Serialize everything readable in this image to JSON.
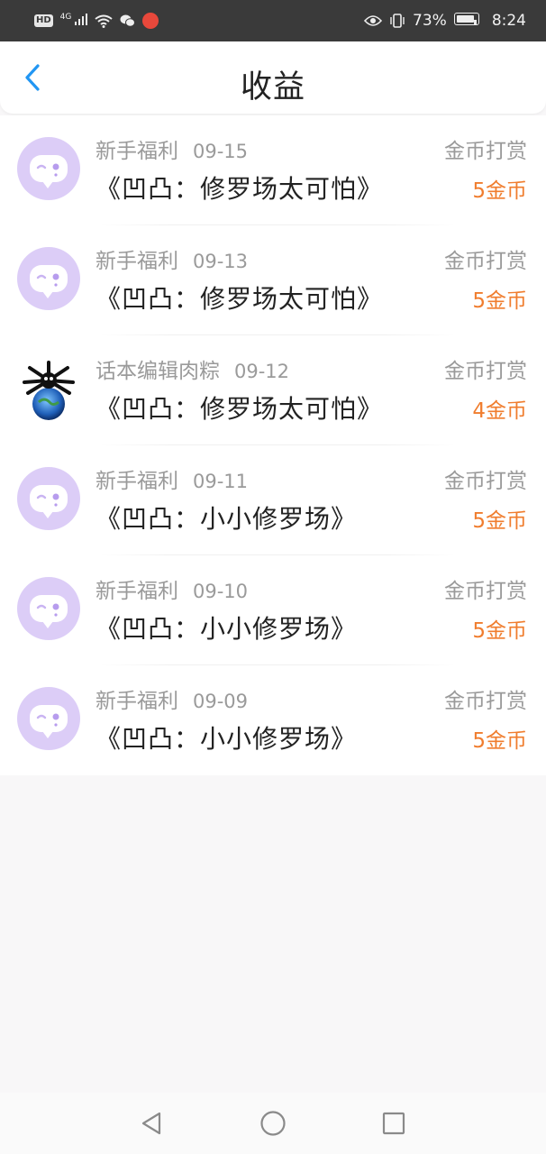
{
  "status_bar": {
    "battery": "73%",
    "time": "8:24",
    "network": "4G",
    "hd": "HD"
  },
  "header": {
    "title": "收益",
    "back_icon": "chevron-left-icon",
    "accent_color": "#2196f3"
  },
  "items": [
    {
      "source": "新手福利",
      "date": "09-15",
      "reward_type": "金币打赏",
      "book": "《凹凸：修罗场太可怕》",
      "amount": "5金币",
      "avatar": "chat-bubble-avatar"
    },
    {
      "source": "新手福利",
      "date": "09-13",
      "reward_type": "金币打赏",
      "book": "《凹凸：修罗场太可怕》",
      "amount": "5金币",
      "avatar": "chat-bubble-avatar"
    },
    {
      "source": "话本编辑肉粽",
      "date": "09-12",
      "reward_type": "金币打赏",
      "book": "《凹凸：修罗场太可怕》",
      "amount": "4金币",
      "avatar": "user-photo-avatar"
    },
    {
      "source": "新手福利",
      "date": "09-11",
      "reward_type": "金币打赏",
      "book": "《凹凸：小小修罗场》",
      "amount": "5金币",
      "avatar": "chat-bubble-avatar"
    },
    {
      "source": "新手福利",
      "date": "09-10",
      "reward_type": "金币打赏",
      "book": "《凹凸：小小修罗场》",
      "amount": "5金币",
      "avatar": "chat-bubble-avatar"
    },
    {
      "source": "新手福利",
      "date": "09-09",
      "reward_type": "金币打赏",
      "book": "《凹凸：小小修罗场》",
      "amount": "5金币",
      "avatar": "chat-bubble-avatar"
    }
  ],
  "colors": {
    "amount": "#f07d2e",
    "avatar_bg": "#dccdf7",
    "muted_text": "#9a9a9a"
  },
  "navbar": {
    "back": "triangle-back-icon",
    "home": "circle-home-icon",
    "recents": "square-recents-icon"
  }
}
